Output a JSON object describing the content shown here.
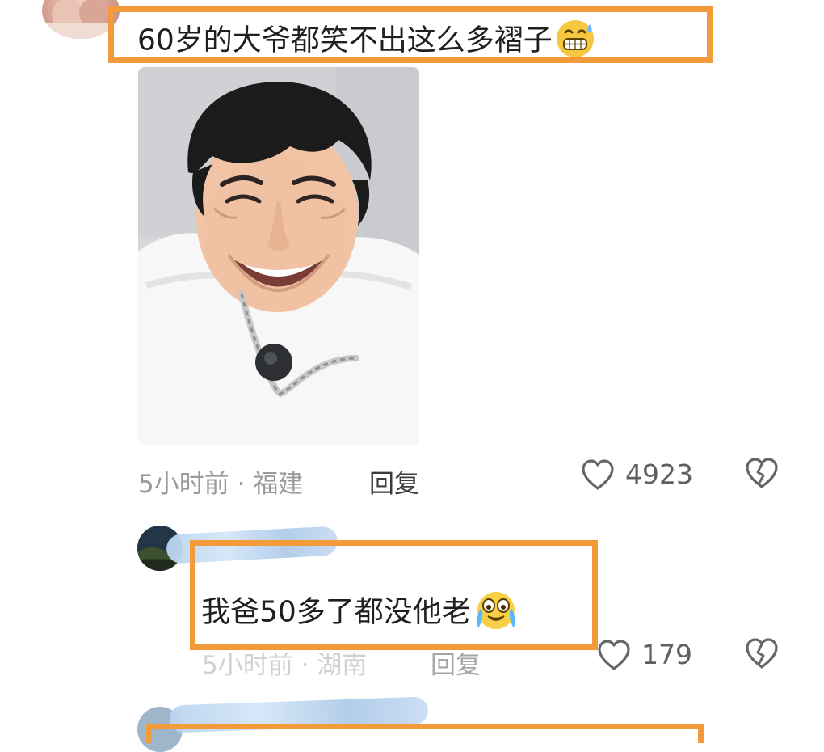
{
  "comments": [
    {
      "text": "60岁的大爷都笑不出这么多褶子",
      "emoji": "grimacing-sweat-emoji",
      "meta": "5小时前 · 福建",
      "reply_label": "回复",
      "likes": "4923"
    },
    {
      "text": "我爸50多了都没他老",
      "emoji": "crying-tears-emoji",
      "meta": "5小时前 · 湖南",
      "reply_label": "回复",
      "likes": "179"
    }
  ],
  "colors": {
    "highlight": "#f39a3a",
    "muted": "#9a9a9a",
    "text": "#1f1f1f"
  }
}
